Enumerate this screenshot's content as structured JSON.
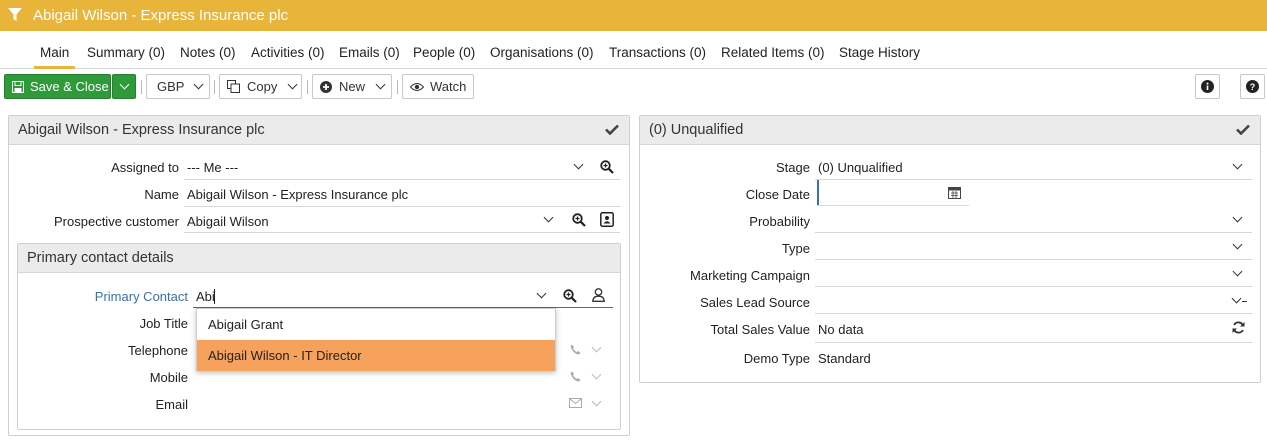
{
  "title": "Abigail Wilson - Express Insurance plc",
  "tabs": [
    "Main",
    "Summary (0)",
    "Notes (0)",
    "Activities (0)",
    "Emails (0)",
    "People (0)",
    "Organisations (0)",
    "Transactions (0)",
    "Related Items (0)",
    "Stage History"
  ],
  "toolbar": {
    "save_close": "Save & Close",
    "currency": "GBP",
    "copy": "Copy",
    "new": "New",
    "watch": "Watch"
  },
  "left_panel": {
    "title": "Abigail Wilson - Express Insurance plc",
    "fields": {
      "assigned_to_label": "Assigned to",
      "assigned_to_value": "--- Me ---",
      "name_label": "Name",
      "name_value": "Abigail Wilson - Express Insurance plc",
      "prospect_label": "Prospective customer",
      "prospect_value": "Abigail Wilson"
    },
    "contact_section": {
      "title": "Primary contact details",
      "primary_contact_label": "Primary Contact",
      "primary_contact_value": "Abi",
      "job_title_label": "Job Title",
      "telephone_label": "Telephone",
      "mobile_label": "Mobile",
      "email_label": "Email"
    },
    "suggestions": [
      "Abigail Grant",
      "Abigail Wilson - IT Director"
    ]
  },
  "right_panel": {
    "title": "(0) Unqualified",
    "stage_label": "Stage",
    "stage_value": "(0) Unqualified",
    "close_date_label": "Close Date",
    "probability_label": "Probability",
    "type_label": "Type",
    "marketing_label": "Marketing Campaign",
    "lead_source_label": "Sales Lead Source",
    "total_sales_label": "Total Sales Value",
    "total_sales_value": "No data",
    "demo_type_label": "Demo Type",
    "demo_type_value": "Standard"
  },
  "colors": {
    "header": "#e8b53a",
    "save_button": "#2e9a3a",
    "highlight": "#f6a25c",
    "link_label": "#3a6fa8"
  }
}
